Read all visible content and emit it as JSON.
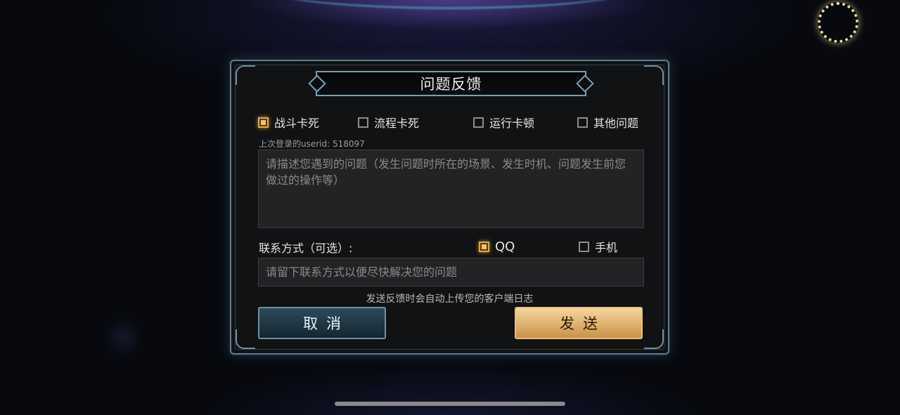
{
  "dialog": {
    "title": "问题反馈",
    "issue_types": [
      {
        "label": "战斗卡死",
        "checked": true
      },
      {
        "label": "流程卡死",
        "checked": false
      },
      {
        "label": "运行卡顿",
        "checked": false
      },
      {
        "label": "其他问题",
        "checked": false
      }
    ],
    "userid_line": "上次登录的userid: 518097",
    "description_placeholder": "请描述您遇到的问题（发生问题时所在的场景、发生时机、问题发生前您做过的操作等）",
    "contact_label": "联系方式（可选）:",
    "contact_options": [
      {
        "label": "QQ",
        "checked": true
      },
      {
        "label": "手机",
        "checked": false
      }
    ],
    "contact_placeholder": "请留下联系方式以便尽快解决您的问题",
    "log_note": "发送反馈时会自动上传您的客户端日志",
    "cancel_label": "取消",
    "send_label": "发送"
  },
  "colors": {
    "checked_accent": "#e2a94a",
    "frame": "#5f7d92",
    "send_button": "#e8bd74",
    "cancel_button": "#2d4a5a"
  }
}
